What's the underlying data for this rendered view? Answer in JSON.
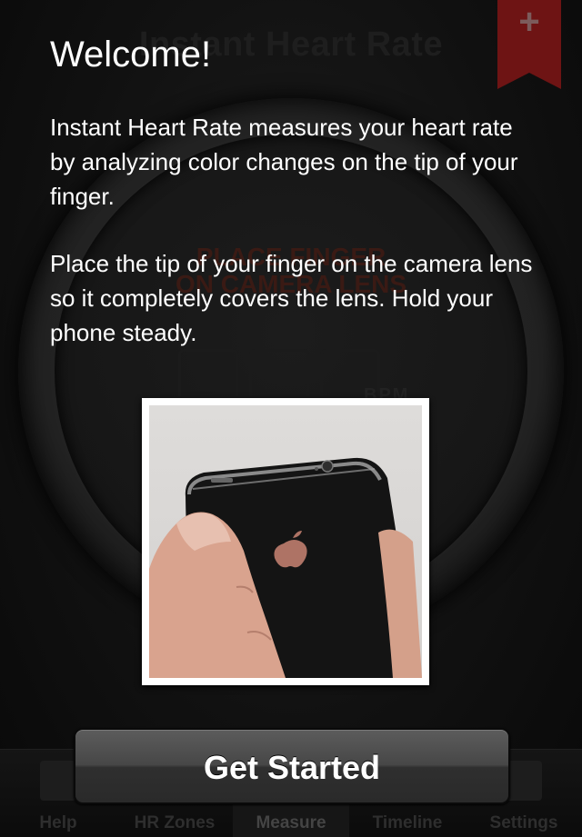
{
  "background_app": {
    "title": "Instant Heart Rate",
    "instruction_line1": "PLACE FINGER",
    "instruction_line2": "ON CAMERA LENS",
    "bpm_label": "BPM",
    "add_symbol": "+"
  },
  "overlay": {
    "heading": "Welcome!",
    "paragraph1": "Instant Heart Rate measures your heart rate by analyzing color changes on the tip of your finger.",
    "paragraph2": "Place the tip of your finger on the camera lens so it completely covers the lens. Hold your phone steady.",
    "button_label": "Get Started"
  },
  "tabbar": {
    "tabs": [
      {
        "label": "Help",
        "icon": "book-icon",
        "active": false
      },
      {
        "label": "HR Zones",
        "icon": "runner-icon",
        "active": false
      },
      {
        "label": "Measure",
        "icon": "heart-icon",
        "active": true
      },
      {
        "label": "Timeline",
        "icon": "list-icon",
        "active": false
      },
      {
        "label": "Settings",
        "icon": "sliders-icon",
        "active": false
      }
    ]
  },
  "colors": {
    "background": "#0e0e0e",
    "overlay_text": "#ffffff",
    "bookmark": "#6e1414",
    "button_top": "#5c5c5c",
    "button_bottom": "#2a2a2a"
  }
}
